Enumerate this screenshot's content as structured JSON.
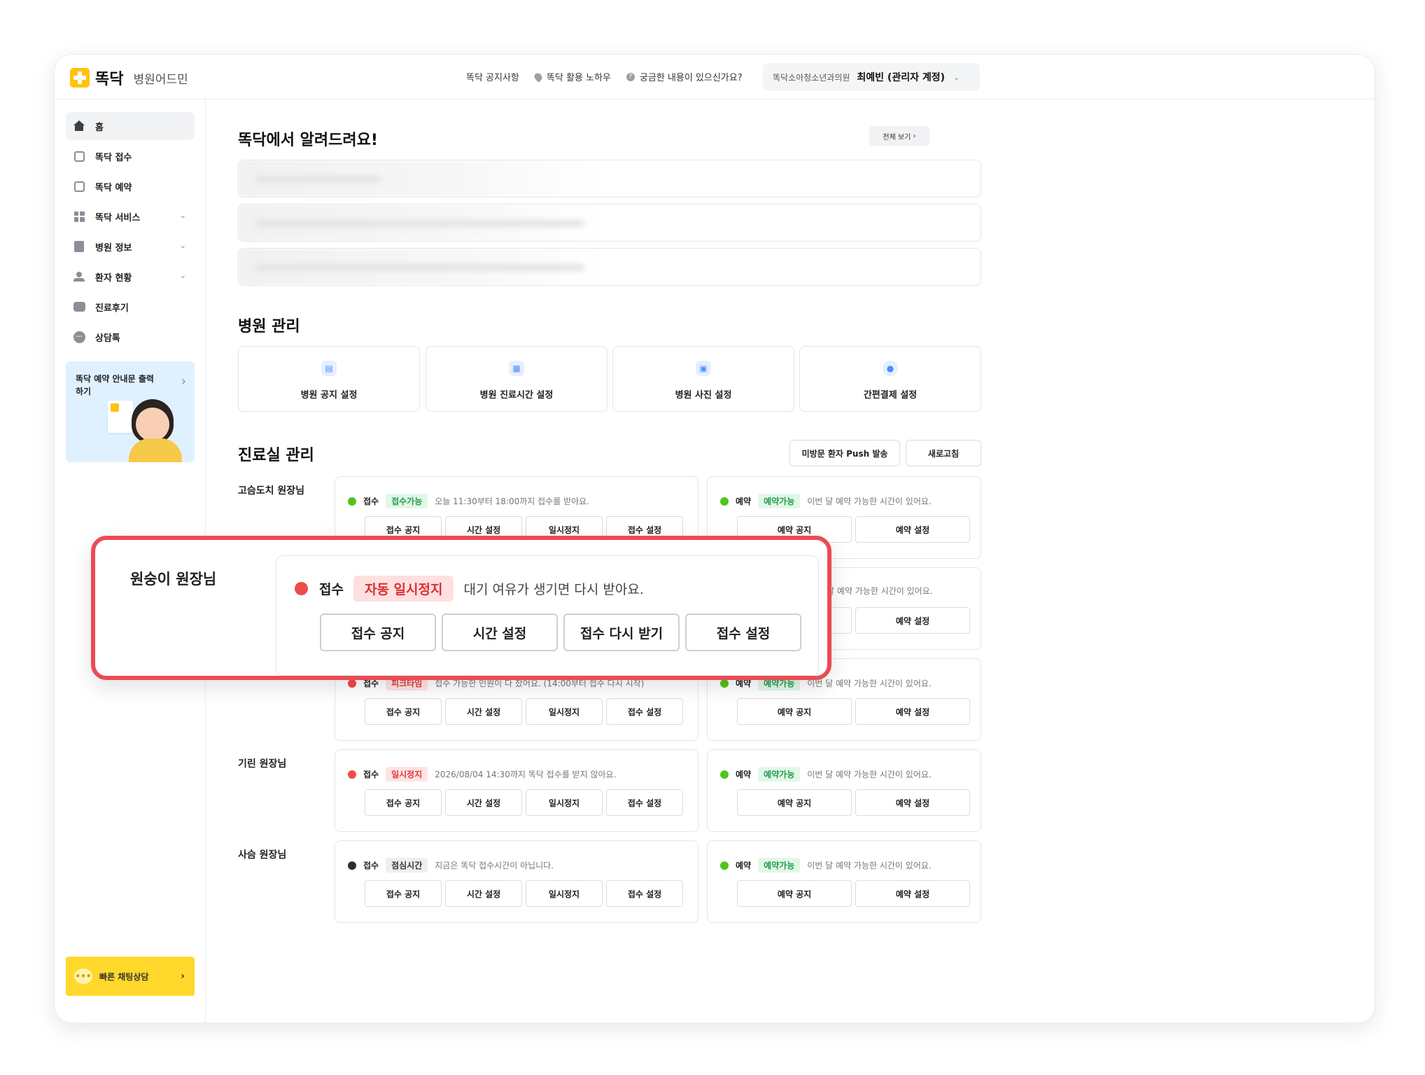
{
  "header": {
    "brand": "똑닥",
    "brand_sub": "병원어드민",
    "nav": [
      "똑닥 공지사항",
      "똑닥 활용 노하우",
      "궁금한 내용이 있으신가요?"
    ],
    "hospital": "똑닥소아청소년과의원",
    "user": "최예빈 (관리자 계정)"
  },
  "sidebar": {
    "items": [
      {
        "label": "홈",
        "icon": "home-icon"
      },
      {
        "label": "똑닥 접수",
        "icon": "reception-icon"
      },
      {
        "label": "똑닥 예약",
        "icon": "calendar-icon"
      },
      {
        "label": "똑닥 서비스",
        "icon": "apps-icon"
      },
      {
        "label": "병원 정보",
        "icon": "building-icon"
      },
      {
        "label": "환자 현황",
        "icon": "people-icon"
      },
      {
        "label": "진료후기",
        "icon": "review-icon"
      },
      {
        "label": "상담톡",
        "icon": "chat-icon"
      }
    ],
    "promo_text": "똑닥 예약 안내문 출력하기",
    "chat_label": "빠른 채팅상담"
  },
  "notices": {
    "title": "똑닥에서 알려드려요!",
    "view_all": "전체 보기"
  },
  "hospital_mgmt": {
    "title": "병원 관리",
    "cards": [
      "병원 공지 설정",
      "병원 진료시간 설정",
      "병원 사진 설정",
      "간편결제 설정"
    ]
  },
  "clinic": {
    "title": "진료실 관리",
    "push_btn": "미방문 환자 Push 발송",
    "refresh_btn": "새로고침",
    "reception_label": "접수",
    "reservation_label": "예약",
    "rec_buttons": [
      "접수 공지",
      "시간 설정",
      "일시정지",
      "접수 설정"
    ],
    "res_buttons": [
      "예약 공지",
      "예약 설정"
    ],
    "doctors": [
      {
        "name": "고슴도치 원장님",
        "rec_badge": "접수가능",
        "rec_text": "오늘 11:30부터 18:00까지 접수를 받아요.",
        "res_badge": "예약가능",
        "res_text": "이번 달 예약 가능한 시간이 있어요."
      },
      {
        "name": "",
        "rec_badge": "",
        "rec_text": "",
        "res_badge": "",
        "res_text": "달 예약 가능한 시간이 있어요."
      },
      {
        "name": "",
        "rec_badge": "피크타임",
        "rec_text": "접수 가능한 인원이 다 찼어요. (14:00부터 접수 다시 시작)",
        "res_badge": "예약가능",
        "res_text": "이번 달 예약 가능한 시간이 있어요."
      },
      {
        "name": "기린 원장님",
        "rec_badge": "일시정지",
        "rec_text": "2026/08/04 14:30까지 똑닥 접수를 받지 않아요.",
        "res_badge": "예약가능",
        "res_text": "이번 달 예약 가능한 시간이 있어요."
      },
      {
        "name": "사슴 원장님",
        "rec_badge": "점심시간",
        "rec_text": "지금은 똑닥 접수시간이 아닙니다.",
        "res_badge": "예약가능",
        "res_text": "이번 달 예약 가능한 시간이 있어요."
      }
    ]
  },
  "highlight": {
    "name": "원숭이 원장님",
    "label": "접수",
    "badge": "자동 일시정지",
    "text": "대기 여유가 생기면 다시 받아요.",
    "buttons": [
      "접수 공지",
      "시간 설정",
      "접수 다시 받기",
      "접수 설정"
    ]
  },
  "colors": {
    "accent": "#ffc20e",
    "highlight_border": "#ec4b52",
    "ok": "#52c41a",
    "stop": "#f04b4b"
  }
}
